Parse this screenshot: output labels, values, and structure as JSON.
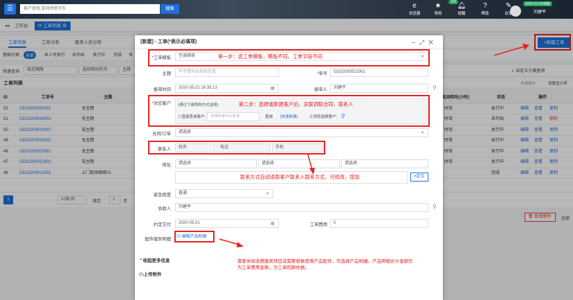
{
  "topbar": {
    "search_placeholder": "客户查找,支持拼音字头",
    "search_btn": "搜索",
    "icons": [
      {
        "icon": "browser-icon",
        "label": "浏览器"
      },
      {
        "icon": "star-icon",
        "label": "常用"
      },
      {
        "icon": "bell-icon",
        "label": "提醒"
      },
      {
        "icon": "help-icon",
        "label": "帮助"
      },
      {
        "icon": "feedback-icon",
        "label": "反馈"
      }
    ],
    "badge": "150",
    "date": "2025-01-02到期",
    "user": "刘建平"
  },
  "tabs": {
    "workbench": "工作台",
    "worklist": "工单列表"
  },
  "subtabs": [
    "工单列表",
    "工单分布",
    "服务人员分布"
  ],
  "filters": {
    "label": "基础分类:",
    "chips": [
      "全部",
      "本人可执行",
      "未开始",
      "执行中",
      "完成",
      "关"
    ]
  },
  "quick": {
    "label": "快速查询:",
    "field1": "效近期限",
    "field2": "选择耗时状况",
    "field3": "主题"
  },
  "list": {
    "title": "工单列表",
    "headers": [
      "ID",
      "工单号",
      "主题",
      "指派耗时(小时)",
      "状态",
      "操作"
    ],
    "rows": [
      {
        "id": "52",
        "no": "GD20200520001",
        "subject": "无主题",
        "time": "时效",
        "status": "执行中"
      },
      {
        "id": "51",
        "no": "GD20200519002",
        "subject": "无主题",
        "time": "时效",
        "status": "未开始"
      },
      {
        "id": "50",
        "no": "GD20200519001",
        "subject": "无主题",
        "time": "时效",
        "status": "执行中"
      },
      {
        "id": "49",
        "no": "GD20200513002",
        "subject": "无主题",
        "time": "时效",
        "status": "执行中"
      },
      {
        "id": "48",
        "no": "GD20200513001",
        "subject": "无主题",
        "time": "时效",
        "status": "执行中"
      },
      {
        "id": "47",
        "no": "GD20200512002",
        "subject": "无主题",
        "time": "时效",
        "status": "执行中"
      },
      {
        "id": "46",
        "no": "GD20200512001",
        "subject": "上门现场维修01",
        "time": "",
        "status": "完成"
      }
    ],
    "ops": {
      "edit": "编辑",
      "view": "查看",
      "copy": "复制",
      "del": "删除"
    },
    "custom_query": "自定义方案查询",
    "select_all": "充满操作",
    "settings": "设置显示项",
    "pager": {
      "page": "1",
      "size": "10条/页",
      "goto": "跳至",
      "unit": "页"
    },
    "batch_delete": "批量删除",
    "all": "全部"
  },
  "new_btn": "+新建工单",
  "modal": {
    "title": "[新建] - 工单(*表示必填项)",
    "template_label": "工单模板",
    "template_value": "空调维修",
    "subject_label": "主题",
    "subject_placeholder": "可不填写由系统生成",
    "no_label": "单号",
    "no_value": "GD20200521001",
    "time_label": "报单时间",
    "time_value": "2020-05-21 16:35:13",
    "reporter_label": "报单人",
    "reporter_value": "刘建平",
    "customer_label": "对应客户",
    "customer_hint": "(通过下面两种方式选择)",
    "customer_opt1": "①直接查询客户:",
    "customer_opt1_ph": "支持拼音字头查询",
    "customer_query": "查询",
    "customer_quick": "[快速新建]",
    "customer_opt2": "②浏览选择客户:",
    "contract_label": "合同/订单",
    "contract_ph": "请选择",
    "contact_label": "联系人",
    "contact_name": "姓名",
    "contact_phone": "电话",
    "contact_mobile": "手机",
    "address_label": "地址",
    "address_ph": "请选择",
    "locate": "定位",
    "urgency_label": "紧急程度",
    "urgency_value": "普通",
    "assist_label": "协助人",
    "assist_value": "刘建平",
    "deadline_label": "约定交付",
    "deadline_value": "2020-05-21",
    "fee_label": "工单费用",
    "fee_value": "0",
    "attach_label": "配件服务明细",
    "attach_btn": "编辑产品明细",
    "more": "收起更多信息",
    "upload": "上传附件",
    "annotations": {
      "step1": "第一步：选工单模板，模板不同，工单字段不同",
      "step2": "第二步：选择或新建客户后，关联调取合同、联系人",
      "contact": "联系方式自动读取客户联系人联系方式，可修改，增加",
      "parts": "需要体现收费服务项目或需要替换使用产品配件，可选择产品明细。产品明细合计金额作为工单费用金额，为工单回款依据。"
    }
  }
}
